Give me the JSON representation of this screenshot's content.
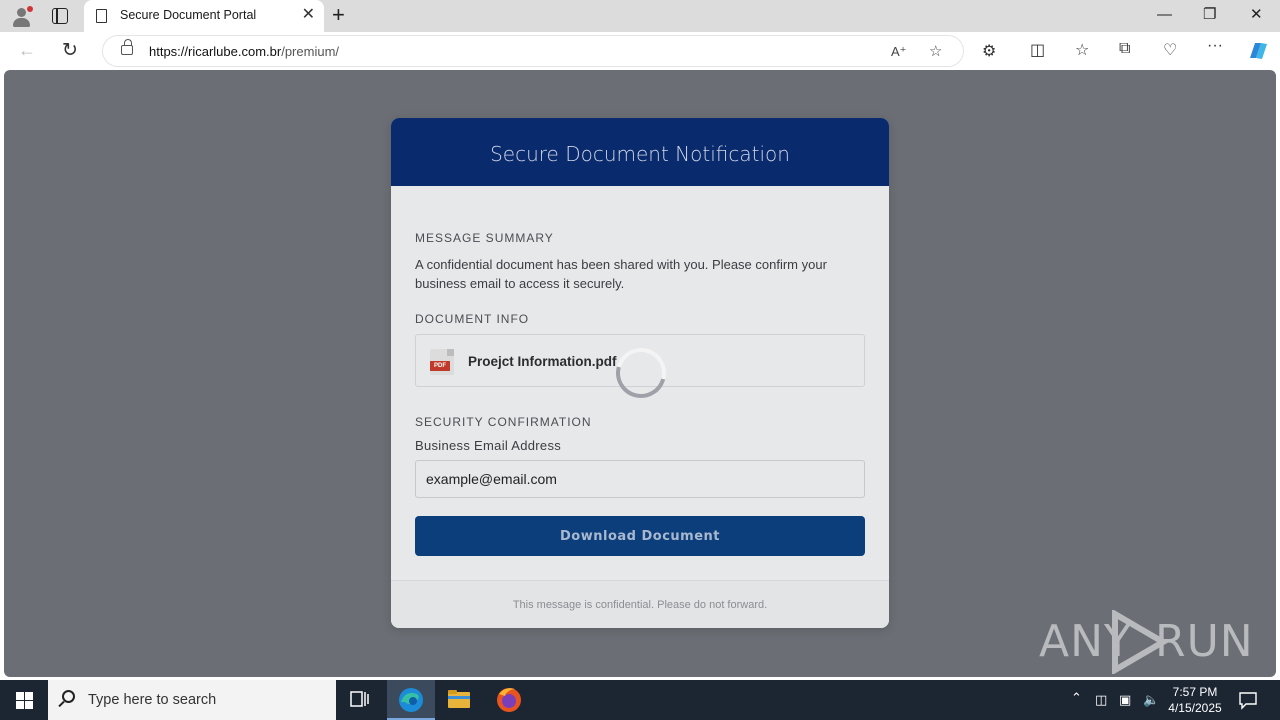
{
  "browser": {
    "tab_title": "Secure Document Portal",
    "tab_close": "✕",
    "new_tab": "+",
    "url_host": "https://ricarlube.com.br",
    "url_path": "/premium/",
    "window_controls": [
      "—",
      "❐",
      "✕"
    ]
  },
  "page": {
    "header_title": "Secure Document Notification",
    "summary_label": "MESSAGE SUMMARY",
    "summary_text": "A confidential document has been shared with you. Please confirm your business email to access it securely.",
    "doc_info_label": "DOCUMENT INFO",
    "doc_icon_tag": "PDF",
    "document_name": "Proejct Information.pdf",
    "security_label": "SECURITY CONFIRMATION",
    "email_label": "Business Email Address",
    "email_value": "example@email.com",
    "download_label": "Download Document",
    "footer_text": "This message is confidential. Please do not forward."
  },
  "watermark": {
    "text_left": "ANY",
    "text_right": "RUN"
  },
  "taskbar": {
    "search_placeholder": "Type here to search",
    "time": "7:57 PM",
    "date": "4/15/2025"
  },
  "colors": {
    "header_bg": "#0a2a6e",
    "button_bg": "#0b3e7a",
    "overlay": "#6b6f75",
    "taskbar": "#1c2633"
  },
  "icons": [
    "profile-icon",
    "tab-actions-icon",
    "page-icon",
    "back-icon",
    "reload-icon",
    "lock-icon",
    "read-aloud-icon",
    "favorite-star-icon",
    "extensions-icon",
    "split-screen-icon",
    "favorites-icon",
    "collections-icon",
    "browser-essentials-icon",
    "more-icon",
    "copilot-icon",
    "pdf-file-icon",
    "loading-spinner-icon",
    "windows-start-icon",
    "search-icon",
    "task-view-icon",
    "edge-icon",
    "file-explorer-icon",
    "firefox-icon",
    "show-hidden-icons-icon",
    "network-icon",
    "volume-icon",
    "notifications-icon"
  ]
}
